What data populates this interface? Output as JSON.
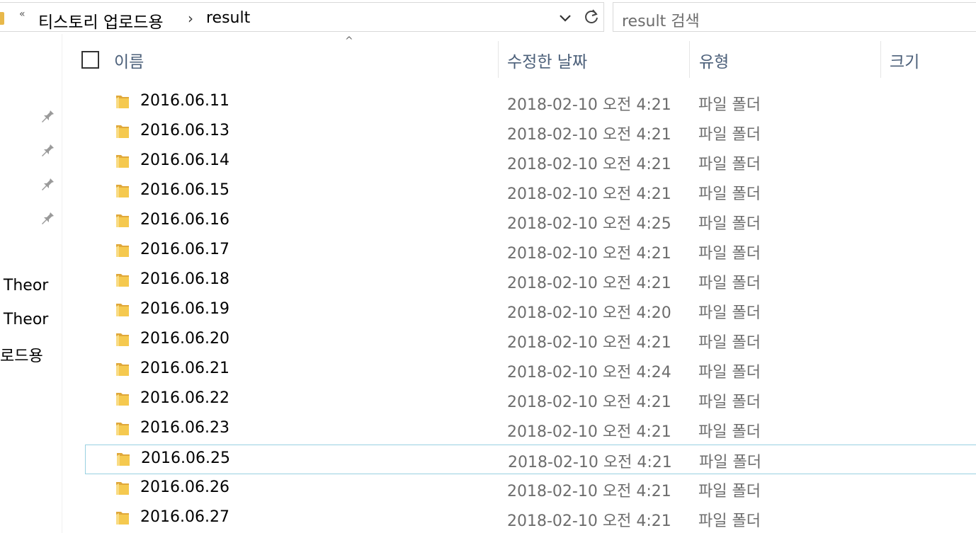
{
  "address_bar": {
    "overflow_chevron": "«",
    "breadcrumbs": [
      "티스토리 업로드용",
      "result"
    ],
    "separator": "›",
    "dropdown_icon": "chevron-down-icon",
    "refresh_icon": "refresh-icon"
  },
  "search": {
    "placeholder": "result 검색"
  },
  "nav_pane": {
    "items": [
      "ng Theor",
      "ng Theor",
      "로드용"
    ],
    "pinned_count": 4
  },
  "columns": {
    "name": "이름",
    "modified": "수정한 날짜",
    "type": "유형",
    "size": "크기",
    "sort_indicator": "^"
  },
  "files": [
    {
      "name": "2016.06.11",
      "modified": "2018-02-10 오전 4:21",
      "type": "파일 폴더"
    },
    {
      "name": "2016.06.13",
      "modified": "2018-02-10 오전 4:21",
      "type": "파일 폴더"
    },
    {
      "name": "2016.06.14",
      "modified": "2018-02-10 오전 4:21",
      "type": "파일 폴더"
    },
    {
      "name": "2016.06.15",
      "modified": "2018-02-10 오전 4:21",
      "type": "파일 폴더"
    },
    {
      "name": "2016.06.16",
      "modified": "2018-02-10 오전 4:25",
      "type": "파일 폴더"
    },
    {
      "name": "2016.06.17",
      "modified": "2018-02-10 오전 4:21",
      "type": "파일 폴더"
    },
    {
      "name": "2016.06.18",
      "modified": "2018-02-10 오전 4:21",
      "type": "파일 폴더"
    },
    {
      "name": "2016.06.19",
      "modified": "2018-02-10 오전 4:20",
      "type": "파일 폴더"
    },
    {
      "name": "2016.06.20",
      "modified": "2018-02-10 오전 4:21",
      "type": "파일 폴더"
    },
    {
      "name": "2016.06.21",
      "modified": "2018-02-10 오전 4:24",
      "type": "파일 폴더"
    },
    {
      "name": "2016.06.22",
      "modified": "2018-02-10 오전 4:21",
      "type": "파일 폴더"
    },
    {
      "name": "2016.06.23",
      "modified": "2018-02-10 오전 4:21",
      "type": "파일 폴더"
    },
    {
      "name": "2016.06.25",
      "modified": "2018-02-10 오전 4:21",
      "type": "파일 폴더",
      "selected": true
    },
    {
      "name": "2016.06.26",
      "modified": "2018-02-10 오전 4:21",
      "type": "파일 폴더"
    },
    {
      "name": "2016.06.27",
      "modified": "2018-02-10 오전 4:21",
      "type": "파일 폴더"
    }
  ],
  "colors": {
    "header_text": "#4c607a",
    "secondary_text": "#6d6d6d",
    "selection_border": "#99d1e1",
    "folder_yellow": "#f5c94f"
  }
}
